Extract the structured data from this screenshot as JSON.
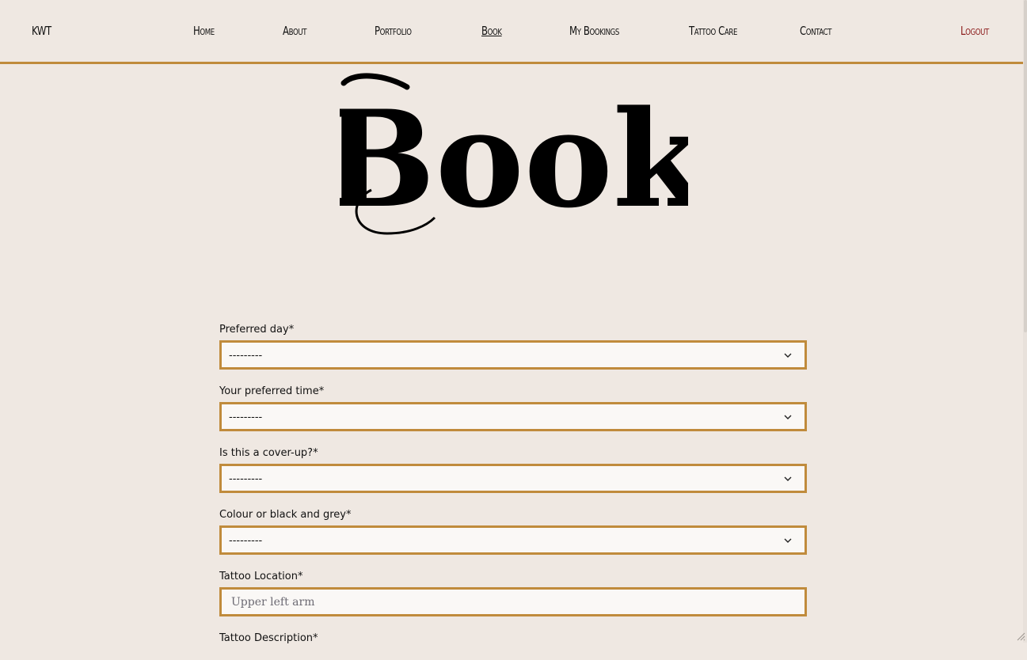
{
  "nav": {
    "brand": "KWT",
    "links": [
      "Home",
      "About",
      "Portfolio",
      "Book",
      "My Bookings",
      "Tattoo Care",
      "Contact"
    ],
    "active": "Book",
    "logout": "Logout"
  },
  "page": {
    "title": "Book"
  },
  "form": {
    "preferred_day": {
      "label": "Preferred day*",
      "value": "---------"
    },
    "preferred_time": {
      "label": "Your preferred time*",
      "value": "---------"
    },
    "cover_up": {
      "label": "Is this a cover-up?*",
      "value": "---------"
    },
    "colour": {
      "label": "Colour or black and grey*",
      "value": "---------"
    },
    "location": {
      "label": "Tattoo Location*",
      "placeholder": "Upper left arm"
    },
    "description": {
      "label": "Tattoo Description*"
    }
  },
  "colors": {
    "background": "#efe8e2",
    "accent": "#c08b3c",
    "logout": "#8b1a1a"
  },
  "icons": [
    "chevron-down-icon",
    "resize-grip-icon"
  ]
}
